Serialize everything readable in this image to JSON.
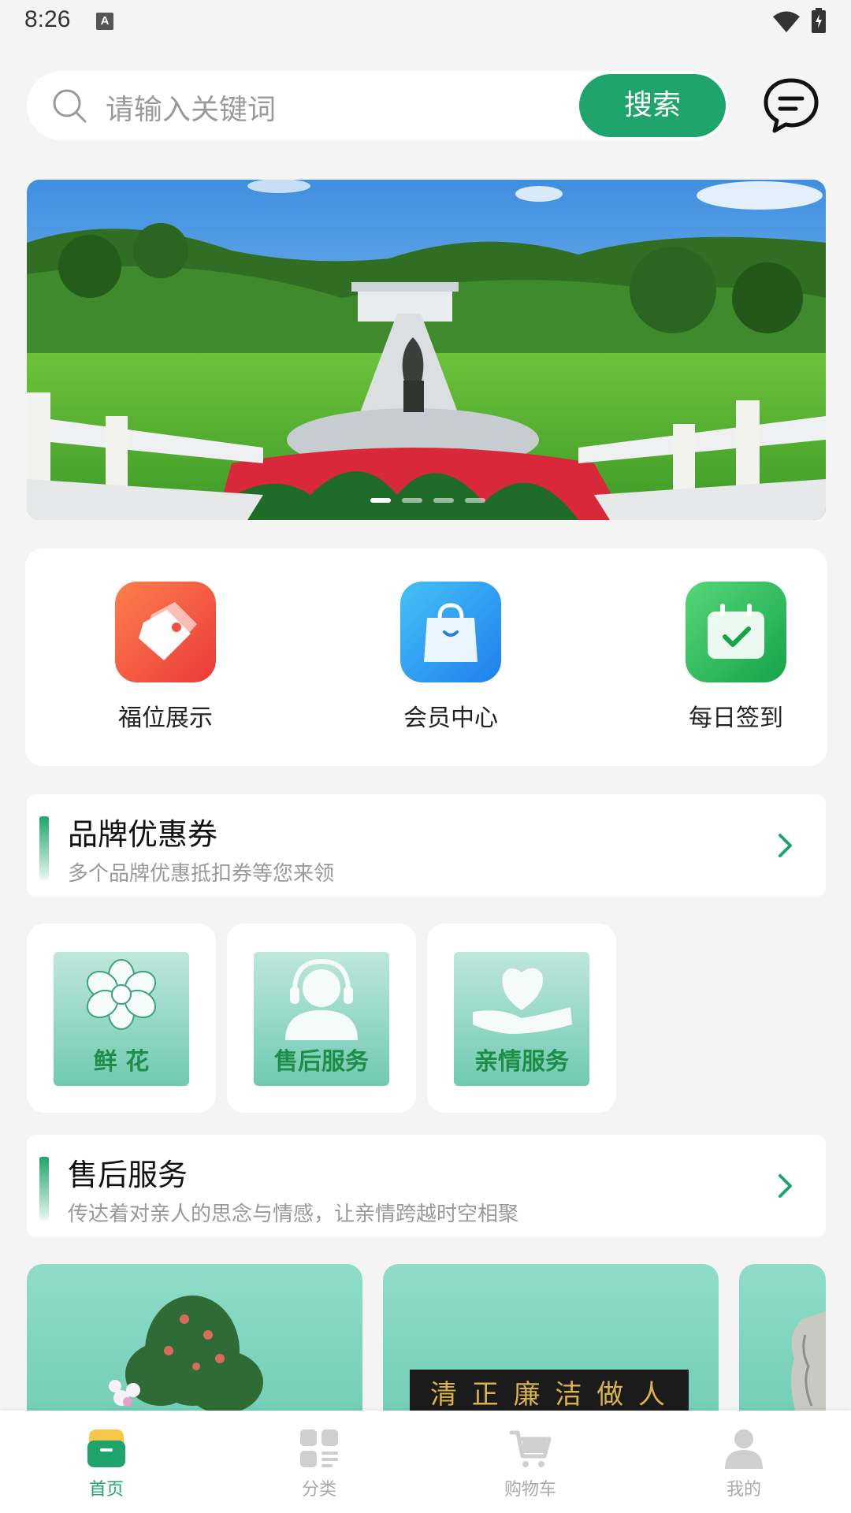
{
  "status_bar": {
    "time": "8:26",
    "input_indicator": "A"
  },
  "search": {
    "placeholder": "请输入关键词",
    "button_label": "搜索"
  },
  "banner": {
    "dot_count": 4,
    "active_dot": 0
  },
  "quick_actions": [
    {
      "label": "福位展示",
      "icon": "tag-icon",
      "color": "#f0523f"
    },
    {
      "label": "会员中心",
      "icon": "shopping-bag-icon",
      "color": "#2e9bf0"
    },
    {
      "label": "每日签到",
      "icon": "calendar-check-icon",
      "color": "#27b45a"
    }
  ],
  "coupon_section": {
    "title": "品牌优惠券",
    "subtitle": "多个品牌优惠抵扣券等您来领"
  },
  "services": [
    {
      "label": "鲜 花",
      "icon": "flower-icon"
    },
    {
      "label": "售后服务",
      "icon": "headset-icon"
    },
    {
      "label": "亲情服务",
      "icon": "heart-hand-icon"
    }
  ],
  "aftersale_section": {
    "title": "售后服务",
    "subtitle": "传达着对亲人的思念与情感，让亲情跨越时空相聚"
  },
  "product_cards": [
    {
      "image": "potted-flowers"
    },
    {
      "image": "calligraphy-plaque",
      "plaque_text": "清 正 廉 洁 做 人"
    },
    {
      "image": "stone-relief"
    }
  ],
  "tab_bar": [
    {
      "label": "首页",
      "icon": "home-icon",
      "active": true
    },
    {
      "label": "分类",
      "icon": "category-icon",
      "active": false
    },
    {
      "label": "购物车",
      "icon": "cart-icon",
      "active": false
    },
    {
      "label": "我的",
      "icon": "user-icon",
      "active": false
    }
  ],
  "colors": {
    "accent": "#1fa56b",
    "background": "#f4f4f4"
  }
}
